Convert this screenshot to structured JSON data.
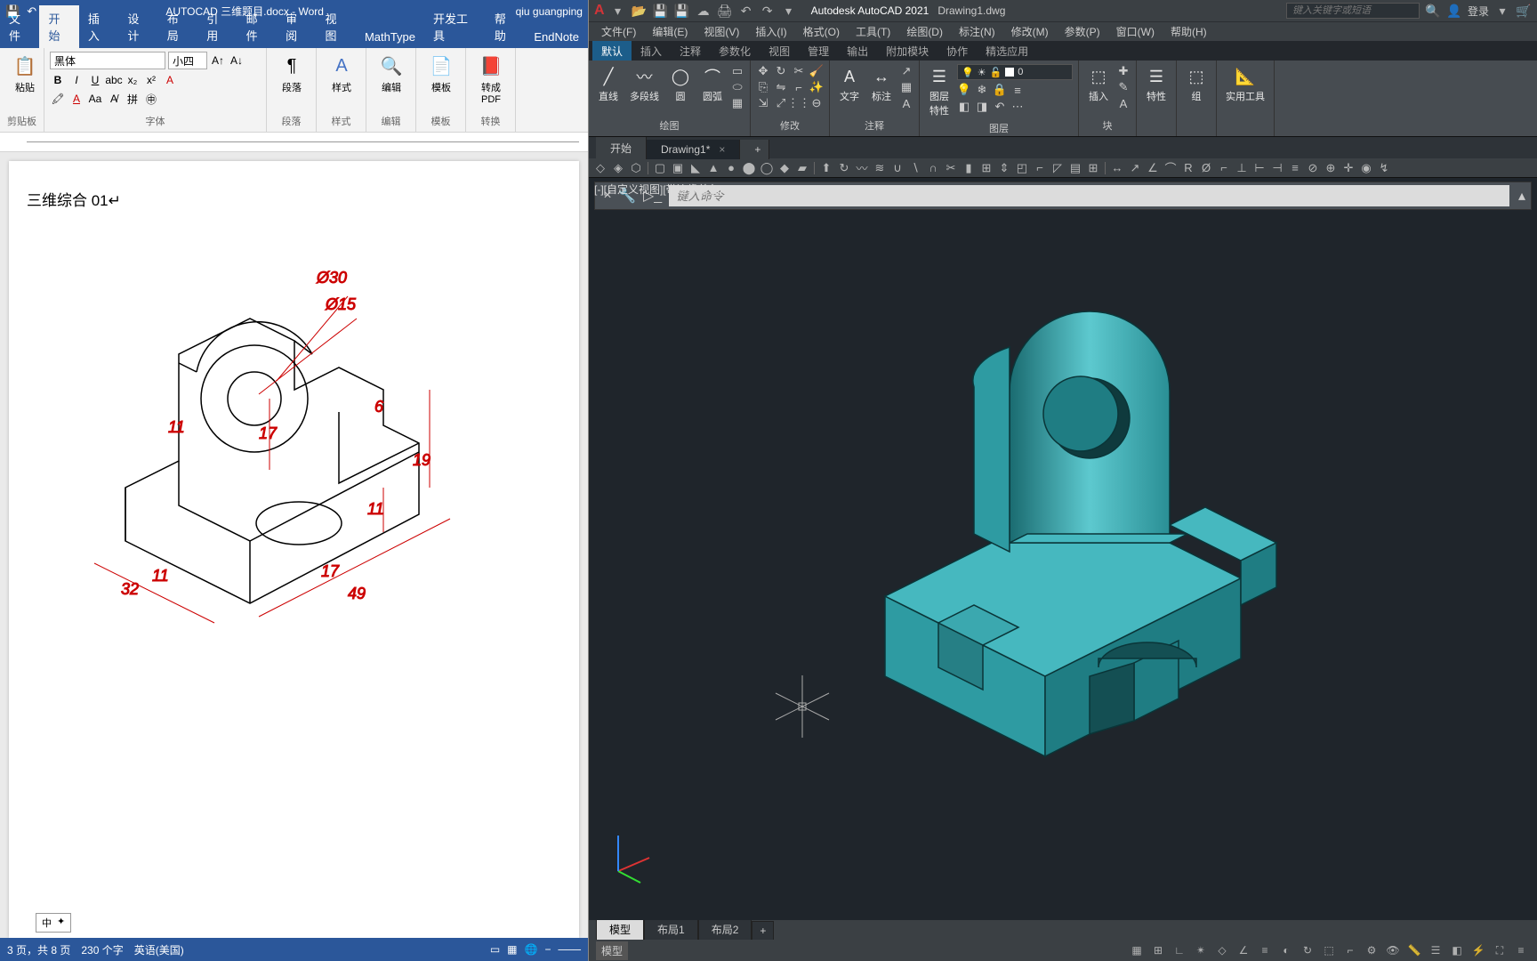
{
  "word": {
    "title_doc": "AUTOCAD 三维题目.docx - Word",
    "user": "qiu guangping",
    "tabs": [
      "文件",
      "开始",
      "插入",
      "设计",
      "布局",
      "引用",
      "邮件",
      "审阅",
      "视图",
      "MathType",
      "开发工具",
      "帮助",
      "EndNote"
    ],
    "active_tab": 1,
    "font_name": "黑体",
    "font_size": "小四",
    "groups": {
      "clipboard": "剪贴板",
      "font": "字体",
      "paragraph": "段落",
      "styles": "样式",
      "editing": "编辑",
      "template": "模板",
      "pdf": "转换",
      "pdf2": "PDF",
      "pdf3": "转换"
    },
    "big_buttons": {
      "paste": "粘贴",
      "paragraph": "段落",
      "styles": "样式",
      "editing": "编辑",
      "template": "模板",
      "pdf": "转成\nPDF"
    },
    "page_heading": "三维综合 01↵",
    "dims": {
      "d30": "Ø30",
      "d15": "Ø15",
      "v11a": "11",
      "v17": "17",
      "v6": "6",
      "v19": "19",
      "v11b": "11",
      "v17b": "17",
      "v49": "49",
      "v32": "32",
      "v11c": "11"
    },
    "status": {
      "pages": "3 页，共 8 页",
      "words": "230 个字",
      "lang": "英语(美国)"
    },
    "ime": {
      "cn": "中",
      "pin": "✦"
    }
  },
  "acad": {
    "app": "Autodesk AutoCAD 2021",
    "file": "Drawing1.dwg",
    "search_ph": "键入关键字或短语",
    "login": "登录",
    "menus": [
      "文件(F)",
      "编辑(E)",
      "视图(V)",
      "插入(I)",
      "格式(O)",
      "工具(T)",
      "绘图(D)",
      "标注(N)",
      "修改(M)",
      "参数(P)",
      "窗口(W)",
      "帮助(H)"
    ],
    "ribbon_tabs": [
      "默认",
      "插入",
      "注释",
      "参数化",
      "视图",
      "管理",
      "输出",
      "附加模块",
      "协作",
      "精选应用"
    ],
    "active_ribbon": 0,
    "groups": {
      "draw": "绘图",
      "modify": "修改",
      "annot": "注释",
      "layers": "图层",
      "block": "块",
      "props": "特性",
      "group": "组",
      "util": "实用工具"
    },
    "draw_btns": {
      "line": "直线",
      "polyline": "多段线",
      "circle": "圆",
      "arc": "圆弧"
    },
    "annot_btns": {
      "text": "文字",
      "dim": "标注"
    },
    "layer_btn": "图层\n特性",
    "layer_current": "0",
    "insert_btn": "插入",
    "props_btn": "特性",
    "group_btn": "组",
    "doc_tabs": {
      "start": "开始",
      "drawing": "Drawing1*"
    },
    "view_label": "[-][自定义视图][带边缘着色]",
    "cmd_ph": "键入命令",
    "layouts": {
      "model": "模型",
      "l1": "布局1",
      "l2": "布局2"
    },
    "status_model": "模型"
  }
}
